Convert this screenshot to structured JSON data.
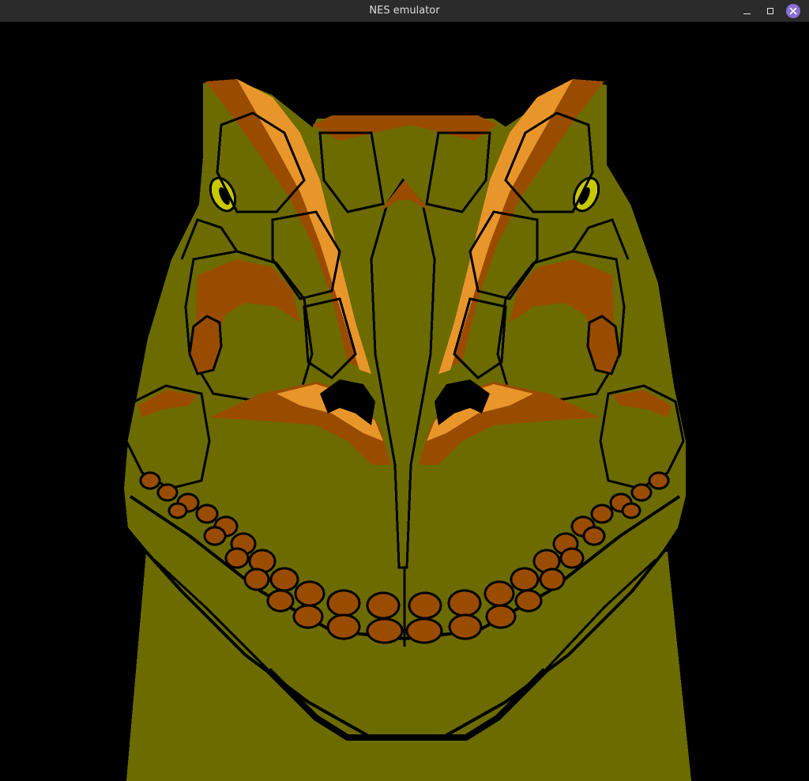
{
  "window": {
    "title": "NES emulator",
    "minimize_icon": "minimize-icon",
    "maximize_icon": "maximize-icon",
    "close_icon": "close-icon"
  },
  "game": {
    "scene": "dinosaur-face-title-art",
    "palette": {
      "background": "#000000",
      "skin": "#6b6b00",
      "orange_dark": "#994c00",
      "orange_light": "#e8962a",
      "eye": "#c8c800",
      "outline": "#000000"
    }
  }
}
